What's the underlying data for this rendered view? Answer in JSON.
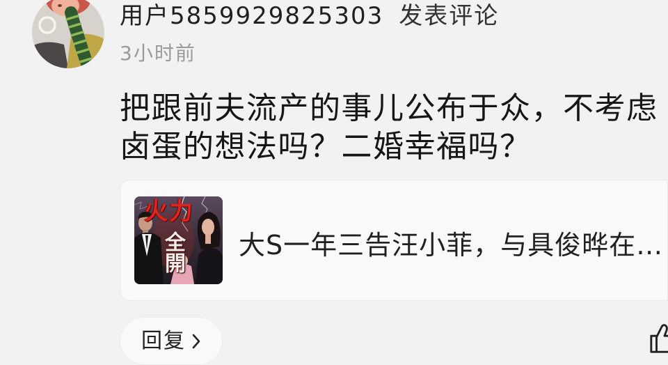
{
  "comment": {
    "username": "用户5859929825303",
    "action_text": "发表评论",
    "time": "3小时前",
    "text": "把跟前夫流产的事儿公布于众，不考虑卤蛋的想法吗？二婚幸福吗？"
  },
  "linked_article": {
    "title": "大S一年三告汪小菲，与具俊晔在…",
    "thumbnail_lettering": {
      "top": "火力",
      "bottom": "全開"
    }
  },
  "actions": {
    "reply_label": "回复",
    "reply_icon": "chevron-right-icon",
    "like_icon": "thumbs-up-icon"
  },
  "colors": {
    "background": "#f2f2f2",
    "card_background": "#f9f9f9",
    "primary_text": "#1c1c1c",
    "secondary_text": "#9a9a9a"
  }
}
